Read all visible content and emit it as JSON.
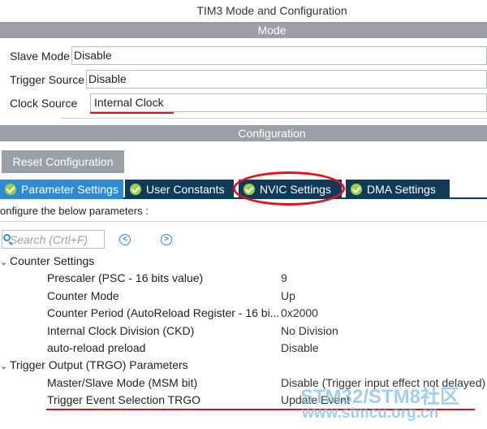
{
  "window": {
    "title": "TIM3 Mode and Configuration"
  },
  "mode_section": {
    "header": "Mode",
    "fields": [
      {
        "label": "Slave Mode",
        "value": "Disable"
      },
      {
        "label": "Trigger Source",
        "value": "Disable"
      },
      {
        "label": "Clock Source",
        "value": "Internal Clock"
      }
    ]
  },
  "config_section": {
    "header": "Configuration",
    "reset_button": "Reset Configuration",
    "tabs": [
      {
        "label": "Parameter Settings",
        "active": true
      },
      {
        "label": "User Constants",
        "active": false
      },
      {
        "label": "NVIC Settings",
        "active": false
      },
      {
        "label": "DMA Settings",
        "active": false
      }
    ],
    "instruction": "onfigure the below parameters :",
    "search": {
      "placeholder": "Search (Crtl+F)",
      "value": ""
    },
    "nav": {
      "prev": "<",
      "next": ">"
    },
    "groups": [
      {
        "title": "Counter Settings",
        "params": [
          {
            "name": "Prescaler (PSC - 16 bits value)",
            "value": "9"
          },
          {
            "name": "Counter Mode",
            "value": "Up"
          },
          {
            "name": "Counter Period (AutoReload Register - 16 bi...",
            "value": "0x2000"
          },
          {
            "name": "Internal Clock Division (CKD)",
            "value": "No Division"
          },
          {
            "name": "auto-reload preload",
            "value": "Disable"
          }
        ]
      },
      {
        "title": "Trigger Output (TRGO) Parameters",
        "params": [
          {
            "name": "Master/Slave Mode (MSM bit)",
            "value": "Disable (Trigger input effect not delayed)"
          },
          {
            "name": "Trigger Event Selection TRGO",
            "value": "Update Event"
          }
        ]
      }
    ]
  },
  "watermark": {
    "line1": "STM32/STM8社区",
    "line2": "www.stmcu.org.cn"
  },
  "colors": {
    "section_bar": "#9aa0a8",
    "tab_dark": "#0f3a5a",
    "tab_active": "#2f8ad4",
    "annotation_red": "#d4141c",
    "check_green": "#9fd04a"
  }
}
